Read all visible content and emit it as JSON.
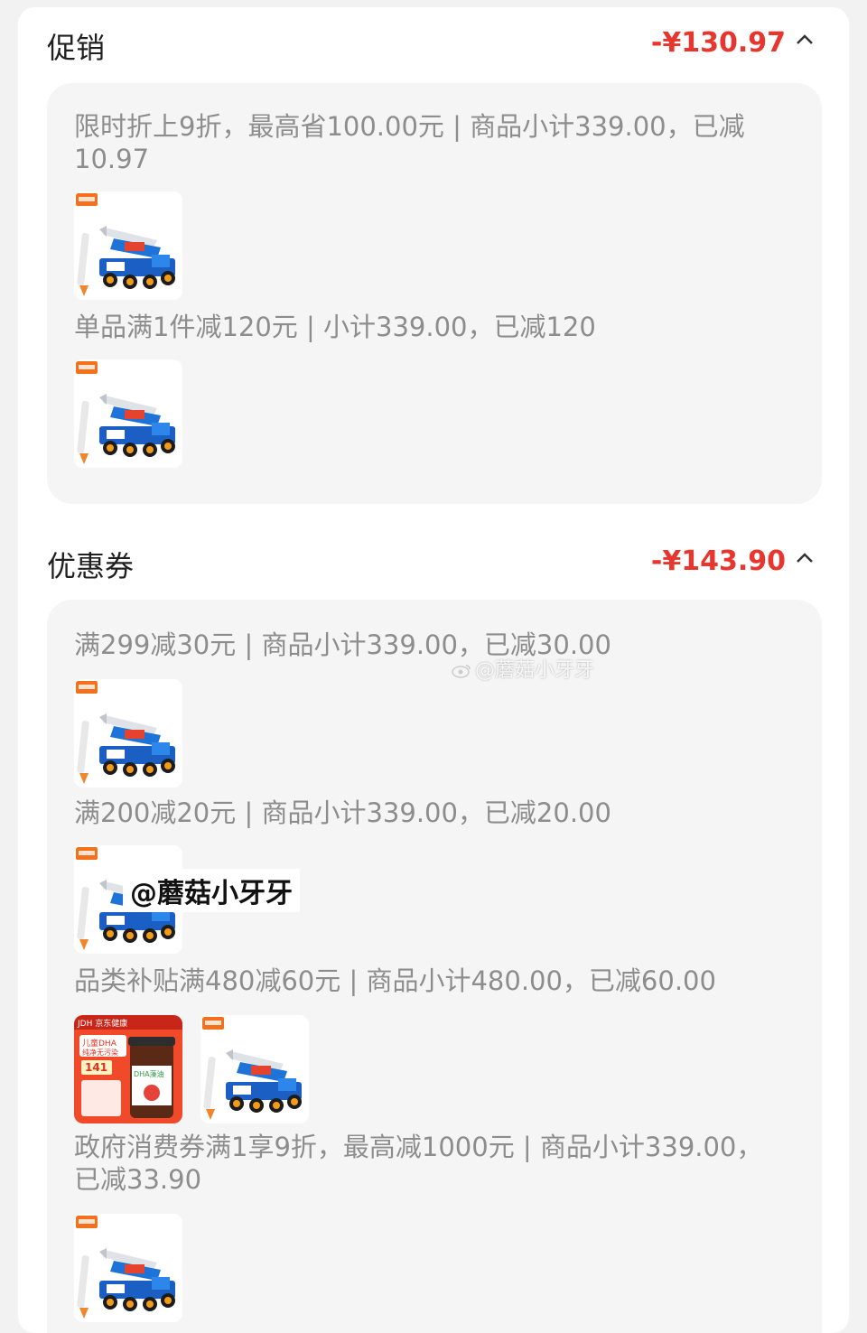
{
  "promo": {
    "title": "促销",
    "amount": "-¥130.97",
    "rules": [
      {
        "text": "限时折上9折，最高省100.00元 | 商品小计339.00，已减10.97"
      },
      {
        "text": "单品满1件减120元 | 小计339.00，已减120"
      }
    ]
  },
  "coupon": {
    "title": "优惠券",
    "amount": "-¥143.90",
    "rules": [
      {
        "text": "满299减30元 | 商品小计339.00，已减30.00"
      },
      {
        "text": "满200减20元 | 商品小计339.00，已减20.00"
      },
      {
        "text": "品类补贴满480减60元 | 商品小计480.00，已减60.00"
      },
      {
        "text": "政府消费券满1享9折，最高减1000元 | 商品小计339.00，已减33.90"
      }
    ]
  },
  "dha_product": {
    "brand": "JDH 京东健康",
    "headline": "儿童DHA",
    "sub": "纯净无污染",
    "price": "141",
    "label": "DHA藻油"
  },
  "watermark_center": "@蘑菇小牙牙",
  "watermark_label": "@蘑菇小牙牙",
  "colors": {
    "accent": "#e8352e",
    "panel": "#f5f5f5",
    "rule_text": "#8d8d8d"
  },
  "icons": {
    "chevron": "chevron-up-icon",
    "weibo": "weibo-eye-icon"
  }
}
